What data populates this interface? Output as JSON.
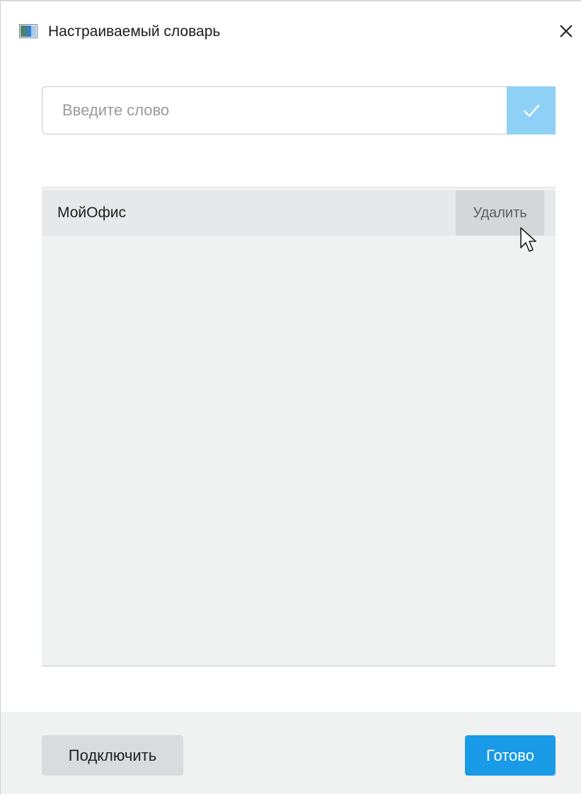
{
  "window": {
    "title": "Настраиваемый словарь",
    "icon": "app-window-icon",
    "close_icon": "close-icon"
  },
  "input": {
    "value": "",
    "placeholder": "Введите слово",
    "confirm_icon": "checkmark-icon",
    "confirm_color": "#8fd0f6"
  },
  "list": {
    "items": [
      {
        "label": "МойОфис",
        "delete_label": "Удалить"
      }
    ]
  },
  "footer": {
    "connect_label": "Подключить",
    "done_label": "Готово",
    "done_color": "#1a9be8"
  }
}
